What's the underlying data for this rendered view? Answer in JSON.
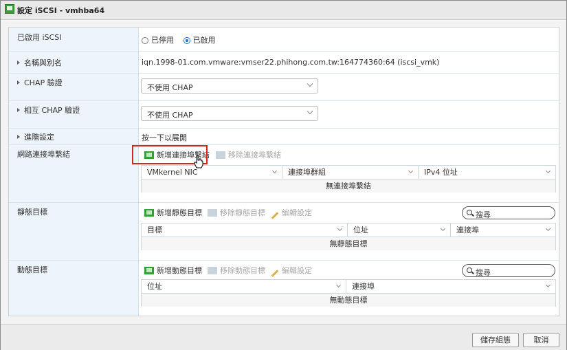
{
  "window": {
    "title": "設定 iSCSI - vmhba64"
  },
  "rows": {
    "enabled": {
      "label": "已啟用 iSCSI",
      "option_disabled": "已停用",
      "option_enabled": "已啟用",
      "selected": "已啟用"
    },
    "name": {
      "label": "名稱與別名",
      "value": "iqn.1998-01.com.vmware:vmser22.phihong.com.tw:164774360:64 (iscsi_vmk)"
    },
    "chap": {
      "label": "CHAP 驗證",
      "value": "不使用 CHAP"
    },
    "mutual_chap": {
      "label": "相互 CHAP 驗證",
      "value": "不使用 CHAP"
    },
    "advanced": {
      "label": "進階設定",
      "value": "按一下以展開"
    },
    "port_binding": {
      "label": "網路連接埠繫結",
      "add_label": "新增連接埠繫結",
      "remove_label": "移除連接埠繫結",
      "columns": [
        "VMkernel NIC",
        "連接埠群組",
        "IPv4 位址"
      ],
      "empty": "無連接埠繫結"
    },
    "static_targets": {
      "label": "靜態目標",
      "add_label": "新增靜態目標",
      "remove_label": "移除靜態目標",
      "edit_label": "編輯設定",
      "search_placeholder": "搜尋",
      "columns": [
        "目標",
        "位址",
        "連接埠"
      ],
      "empty": "無靜態目標"
    },
    "dynamic_targets": {
      "label": "動態目標",
      "add_label": "新增動態目標",
      "remove_label": "移除動態目標",
      "edit_label": "編輯設定",
      "search_placeholder": "搜尋",
      "columns": [
        "位址",
        "連接埠"
      ],
      "empty": "無動態目標"
    }
  },
  "footer": {
    "save_label": "儲存組態",
    "cancel_label": "取消"
  },
  "colors": {
    "accent": "#1a73c8",
    "highlight": "#d9261c",
    "label_bg": "#eef4fb"
  }
}
